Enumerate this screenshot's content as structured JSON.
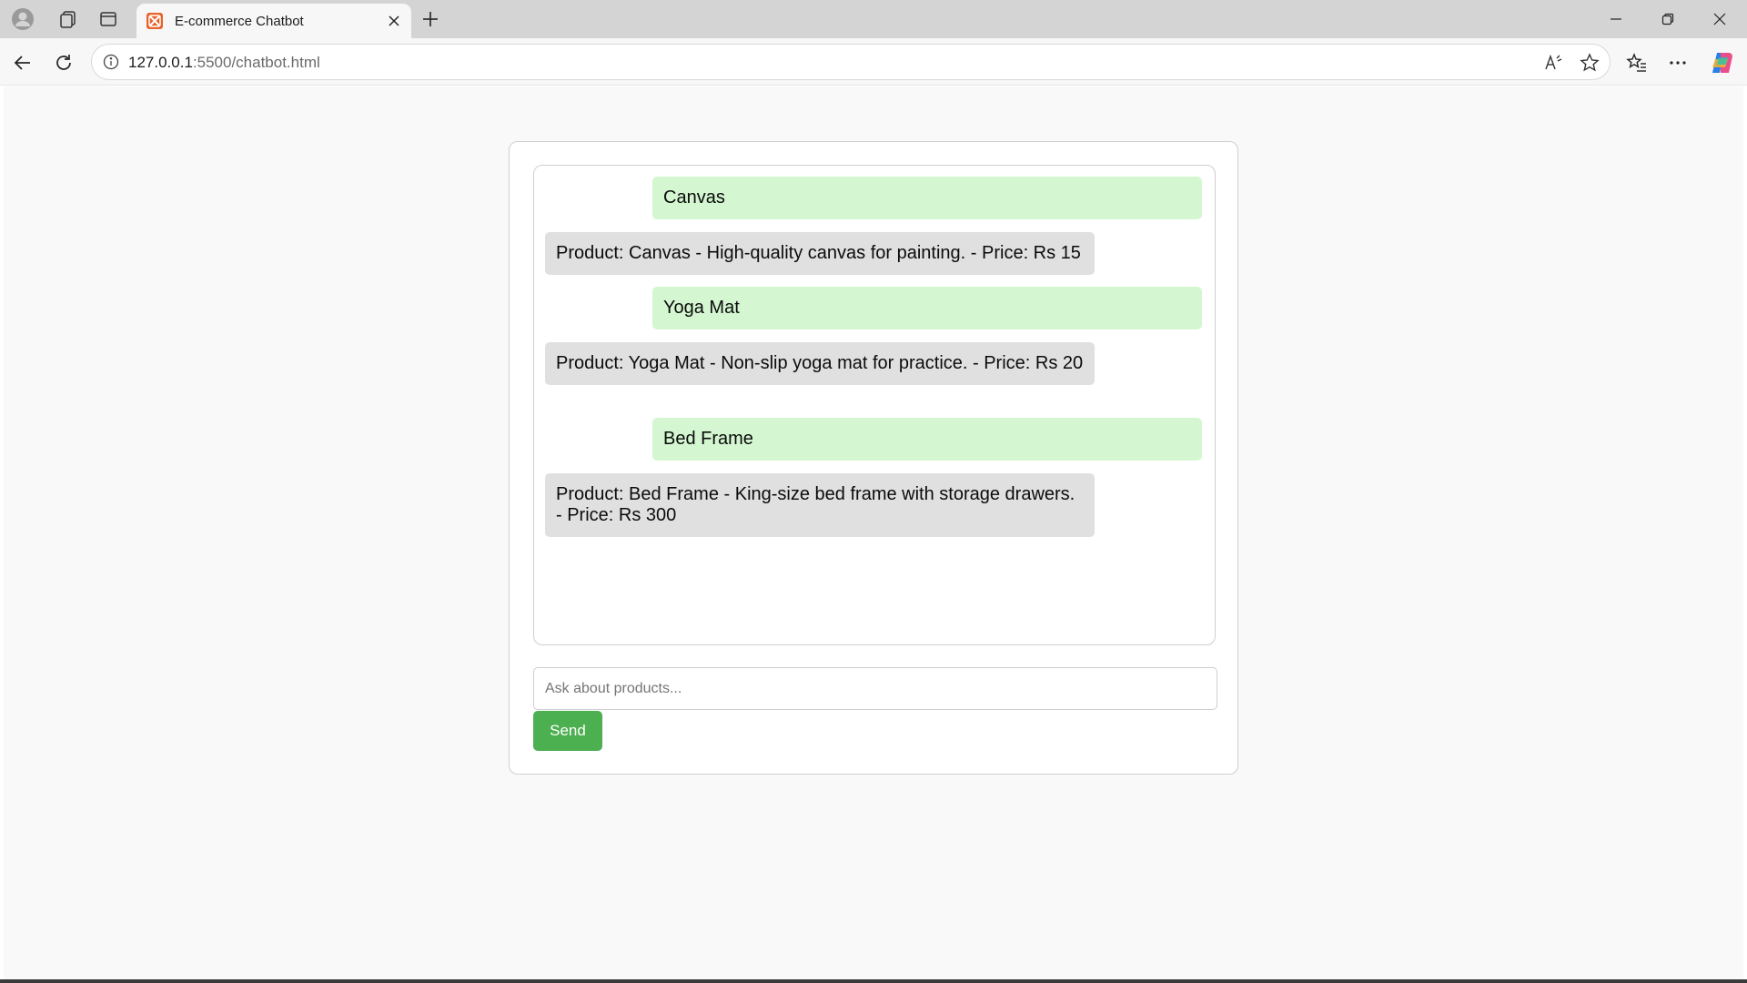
{
  "browser": {
    "tab": {
      "title": "E-commerce Chatbot"
    },
    "address": {
      "host": "127.0.0.1",
      "path": ":5500/chatbot.html"
    },
    "icons": [
      "profile-icon",
      "workspaces-icon",
      "vertical-tabs-icon",
      "favicon-icon",
      "tab-close-icon",
      "new-tab-icon",
      "minimize-icon",
      "restore-icon",
      "window-close-icon",
      "back-icon",
      "refresh-icon",
      "site-info-icon",
      "read-aloud-icon",
      "favorite-star-icon",
      "favorites-icon",
      "more-icon",
      "copilot-icon"
    ]
  },
  "chat": {
    "messages": [
      {
        "sender": "user",
        "text": "Canvas"
      },
      {
        "sender": "bot",
        "text": "Product: Canvas - High-quality canvas for painting. - Price: Rs 15"
      },
      {
        "sender": "user",
        "text": "Yoga Mat"
      },
      {
        "sender": "bot",
        "text": "Product: Yoga Mat - Non-slip yoga mat for practice. - Price: Rs 20"
      },
      {
        "sender": "user",
        "text": "Bed Frame"
      },
      {
        "sender": "bot",
        "text": "Product: Bed Frame - King-size bed frame with storage drawers. - Price: Rs 300"
      }
    ],
    "input": {
      "placeholder": "Ask about products...",
      "value": ""
    },
    "send_label": "Send"
  },
  "colors": {
    "user_bubble": "#d4f7d1",
    "bot_bubble": "#e0e0e0",
    "send_button": "#4caf50",
    "page_background": "#f9f9f9"
  }
}
